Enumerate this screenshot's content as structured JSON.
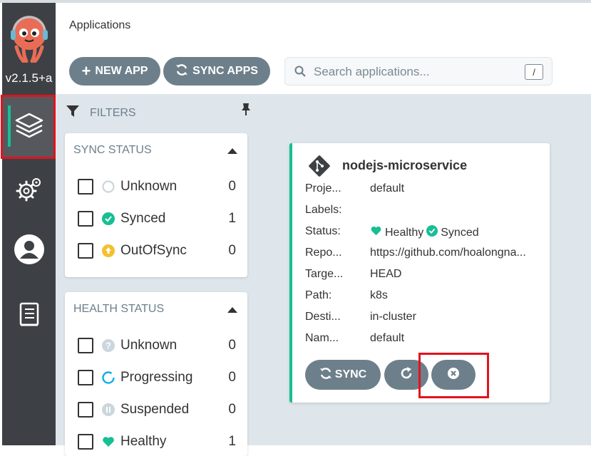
{
  "sidebar": {
    "version": "v2.1.5+a",
    "nav": [
      {
        "name": "Applications",
        "icon": "layers-icon"
      },
      {
        "name": "Settings",
        "icon": "gear-icon"
      },
      {
        "name": "User Info",
        "icon": "user-icon"
      },
      {
        "name": "Documentation",
        "icon": "docs-icon"
      }
    ]
  },
  "header": {
    "title": "Applications",
    "new_app_label": "NEW APP",
    "sync_apps_label": "SYNC APPS",
    "search_placeholder": "Search applications...",
    "search_shortcut": "/"
  },
  "filters": {
    "heading": "FILTERS",
    "sync_status": {
      "title": "SYNC STATUS",
      "items": [
        {
          "label": "Unknown",
          "count": "0",
          "icon": "unknown-circle-icon"
        },
        {
          "label": "Synced",
          "count": "1",
          "icon": "check-circle-icon"
        },
        {
          "label": "OutOfSync",
          "count": "0",
          "icon": "arrow-up-circle-icon"
        }
      ]
    },
    "health_status": {
      "title": "HEALTH STATUS",
      "items": [
        {
          "label": "Unknown",
          "count": "0",
          "icon": "question-circle-icon"
        },
        {
          "label": "Progressing",
          "count": "0",
          "icon": "progress-ring-icon"
        },
        {
          "label": "Suspended",
          "count": "0",
          "icon": "pause-circle-icon"
        },
        {
          "label": "Healthy",
          "count": "1",
          "icon": "heart-icon"
        }
      ]
    }
  },
  "app_card": {
    "name": "nodejs-microservice",
    "rows": [
      {
        "key": "Proje...",
        "value": "default"
      },
      {
        "key": "Labels:",
        "value": ""
      },
      {
        "key": "Status:",
        "value": ""
      },
      {
        "key": "Repo...",
        "value": "https://github.com/hoalongna..."
      },
      {
        "key": "Targe...",
        "value": "HEAD"
      },
      {
        "key": "Path:",
        "value": "k8s"
      },
      {
        "key": "Desti...",
        "value": "in-cluster"
      },
      {
        "key": "Nam...",
        "value": "default"
      }
    ],
    "status_health": "Healthy",
    "status_sync": "Synced",
    "sync_label": "SYNC"
  },
  "colors": {
    "sidebar_bg": "#3d4145",
    "accent_teal": "#18be94",
    "button_gray": "#6d7f8b",
    "main_bg": "#dee6eb",
    "highlight_red": "#e3121c",
    "warning_orange": "#f4c030"
  }
}
